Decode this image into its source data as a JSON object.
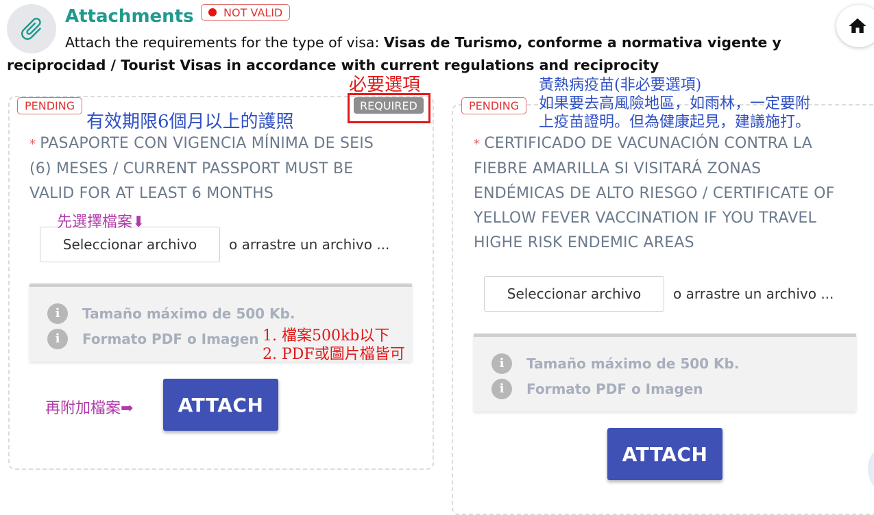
{
  "header": {
    "title": "Attachments",
    "status_badge": "NOT VALID",
    "description_prefix": "Attach the requirements for the type of visa: ",
    "description_bold_line1": "Visas de Turismo, conforme a normativa vigente y",
    "description_bold_line2": "reciprocidad / Tourist Visas in accordance with current regulations and reciprocity"
  },
  "card1": {
    "status": "PENDING",
    "required_label": "REQUIRED",
    "star": "*",
    "title_line1": "PASAPORTE CON VIGENCIA MÍNIMA DE SEIS",
    "title_line2": "(6) MESES / CURRENT PASSPORT MUST BE",
    "title_line3": "VALID FOR AT LEAST 6 MONTHS",
    "file_button": "Seleccionar archivo",
    "drop_text": "o arrastre un archivo ...",
    "info1": "Tamaño máximo de 500 Kb.",
    "info2": "Formato PDF o Imagen",
    "attach": "ATTACH"
  },
  "card2": {
    "status": "PENDING",
    "star": "*",
    "title_line1": "CERTIFICADO DE VACUNACIÓN CONTRA LA",
    "title_line2": "FIEBRE AMARILLA SI VISITARÁ ZONAS",
    "title_line3": "ENDÉMICAS DE ALTO RIESGO / CERTIFICATE OF",
    "title_line4": "YELLOW FEVER VACCINATION IF YOU TRAVEL",
    "title_line5": "HIGHE RISK ENDEMIC AREAS",
    "file_button": "Seleccionar archivo",
    "drop_text": "o arrastre un archivo ...",
    "info1": "Tamaño máximo de 500 Kb.",
    "info2": "Formato PDF o Imagen",
    "attach": "ATTACH"
  },
  "annotations": {
    "required_note": "必要選項",
    "passport_note": "有效期限6個月以上的護照",
    "choose_file_note": "先選擇檔案⬇",
    "size_note": "1. 檔案500kb以下",
    "format_note": "2. PDF或圖片檔皆可",
    "attach_note": "再附加檔案➡",
    "vaccine_note_line1": "黃熱病疫苗(非必要選項)",
    "vaccine_note_line2": "如果要去高風險地區，如雨林，一定要附",
    "vaccine_note_line3": "上疫苗證明。但為健康起見，建議施打。"
  },
  "icons": {
    "attachment": "paperclip-icon",
    "home": "home-icon",
    "info": "info-icon"
  },
  "colors": {
    "title": "#1f9a8e",
    "attach_button": "#3f51b5",
    "pending": "#d33333",
    "annotation_red": "#e01818",
    "annotation_blue": "#2e4fc4",
    "annotation_purple": "#b03aa8"
  }
}
